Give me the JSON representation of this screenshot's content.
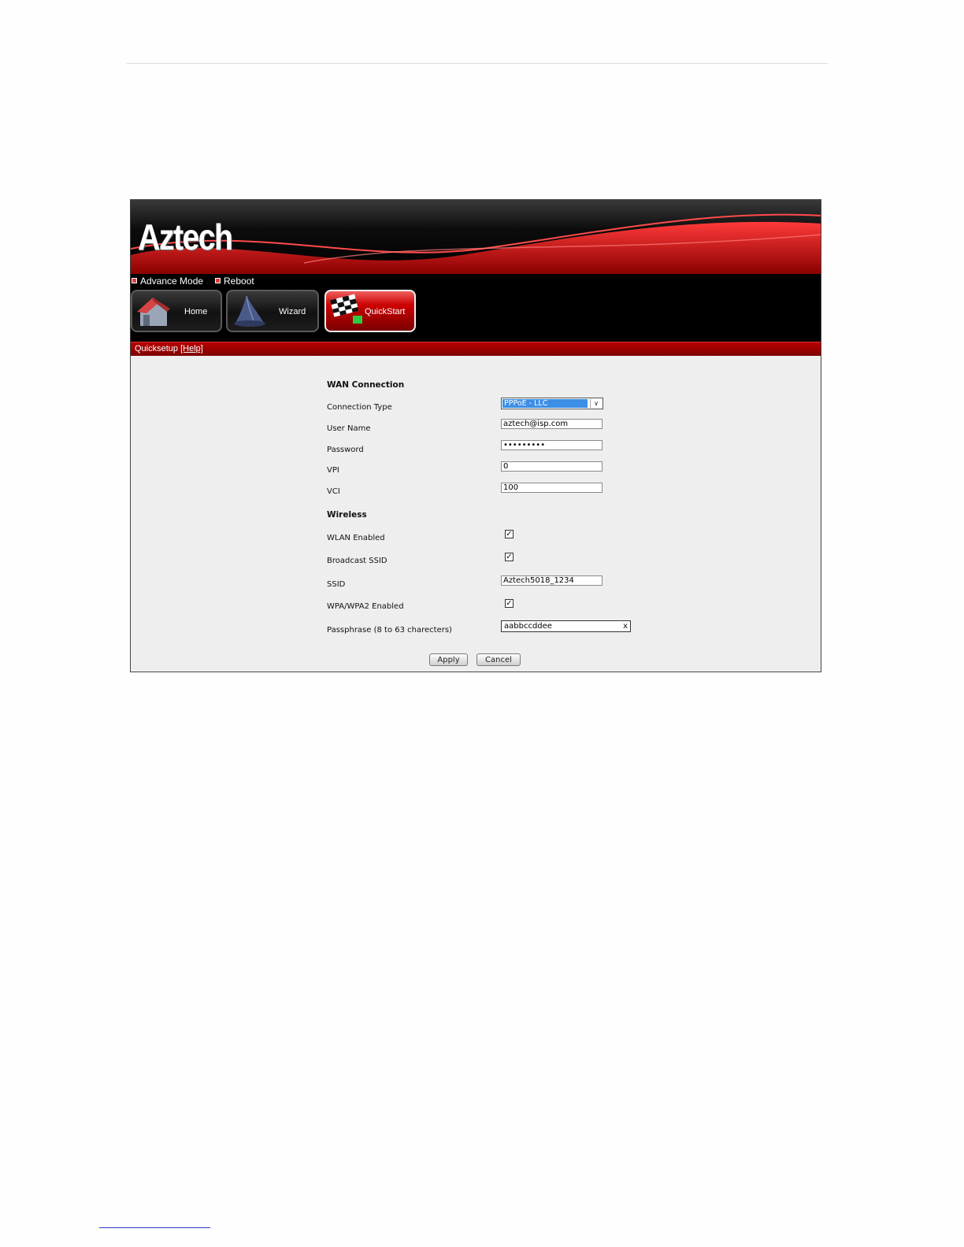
{
  "brand": {
    "logo_text": "Aztech",
    "accent": "#cc0000"
  },
  "top_links": {
    "advance_mode": "Advance Mode",
    "reboot": "Reboot"
  },
  "nav": {
    "home": "Home",
    "wizard": "Wizard",
    "quickstart": "QuickStart"
  },
  "section": {
    "title": "Quicksetup",
    "help": "[Help]"
  },
  "wan": {
    "heading": "WAN Connection",
    "connection_type_label": "Connection Type",
    "connection_type_value": "PPPoE - LLC",
    "user_name_label": "User Name",
    "user_name_value": "aztech@isp.com",
    "password_label": "Password",
    "password_value": "•••••••••",
    "vpi_label": "VPI",
    "vpi_value": "0",
    "vci_label": "VCI",
    "vci_value": "100"
  },
  "wireless": {
    "heading": "Wireless",
    "wlan_enabled_label": "WLAN Enabled",
    "wlan_enabled": true,
    "broadcast_ssid_label": "Broadcast SSID",
    "broadcast_ssid": true,
    "ssid_label": "SSID",
    "ssid_value": "Aztech5018_1234",
    "wpa_label": "WPA/WPA2 Enabled",
    "wpa_enabled": true,
    "passphrase_label": "Passphrase (8 to 63 charecters)",
    "passphrase_value": "aabbccddee",
    "clear_glyph": "x",
    "check_glyph": "✓"
  },
  "actions": {
    "apply": "Apply",
    "cancel": "Cancel"
  }
}
